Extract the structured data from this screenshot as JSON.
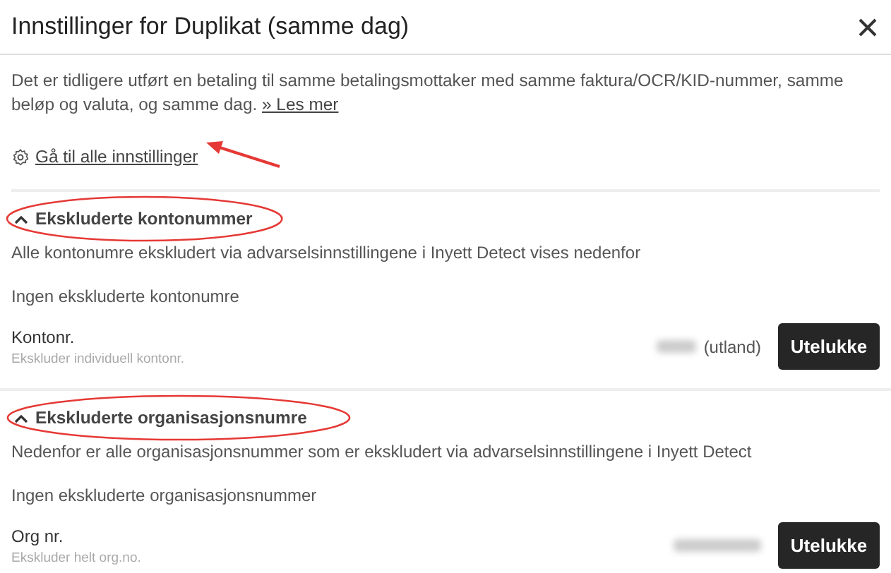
{
  "dialog": {
    "title": "Innstillinger for Duplikat (samme dag)",
    "description": "Det er tidligere utført en betaling til samme betalingsmottaker med samme faktura/OCR/KID-nummer, samme beløp og valuta, og samme dag.",
    "read_more_link": "» Les mer",
    "settings_link": "Gå til alle innstillinger"
  },
  "sections": [
    {
      "heading": "Ekskluderte kontonummer",
      "expanded": true,
      "description": "Alle kontonumre ekskludert via advarselsinnstillingene i Inyett Detect vises nedenfor",
      "empty_text": "Ingen ekskluderte kontonumre",
      "field": {
        "label": "Kontonr.",
        "hint": "Ekskluder individuell kontonr.",
        "suffix": "(utland)"
      },
      "button": "Utelukke"
    },
    {
      "heading": "Ekskluderte organisasjonsnumre",
      "expanded": true,
      "description": "Nedenfor er alle organisasjonsnummer som er ekskludert via advarselsinnstillingene i Inyett Detect",
      "empty_text": "Ingen ekskluderte organisasjonsnummer",
      "field": {
        "label": "Org nr.",
        "hint": "Ekskluder helt org.no."
      },
      "button": "Utelukke"
    }
  ]
}
